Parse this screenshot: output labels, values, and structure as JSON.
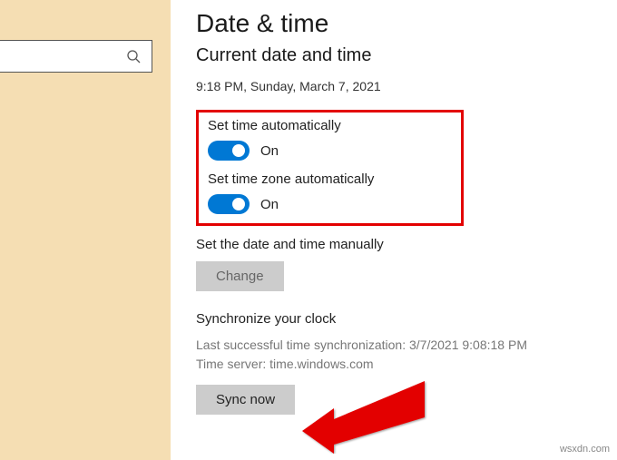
{
  "header": {
    "title": "Date & time",
    "subtitle": "Current date and time",
    "current_datetime": "9:18 PM, Sunday, March 7, 2021"
  },
  "settings": {
    "auto_time": {
      "label": "Set time automatically",
      "state": "On"
    },
    "auto_timezone": {
      "label": "Set time zone automatically",
      "state": "On"
    },
    "manual": {
      "label": "Set the date and time manually",
      "button": "Change"
    }
  },
  "sync": {
    "heading": "Synchronize your clock",
    "last_sync": "Last successful time synchronization: 3/7/2021 9:08:18 PM",
    "server": "Time server: time.windows.com",
    "button": "Sync now"
  },
  "watermark": "wsxdn.com",
  "colors": {
    "accent": "#0078d4",
    "highlight": "#e30000"
  }
}
